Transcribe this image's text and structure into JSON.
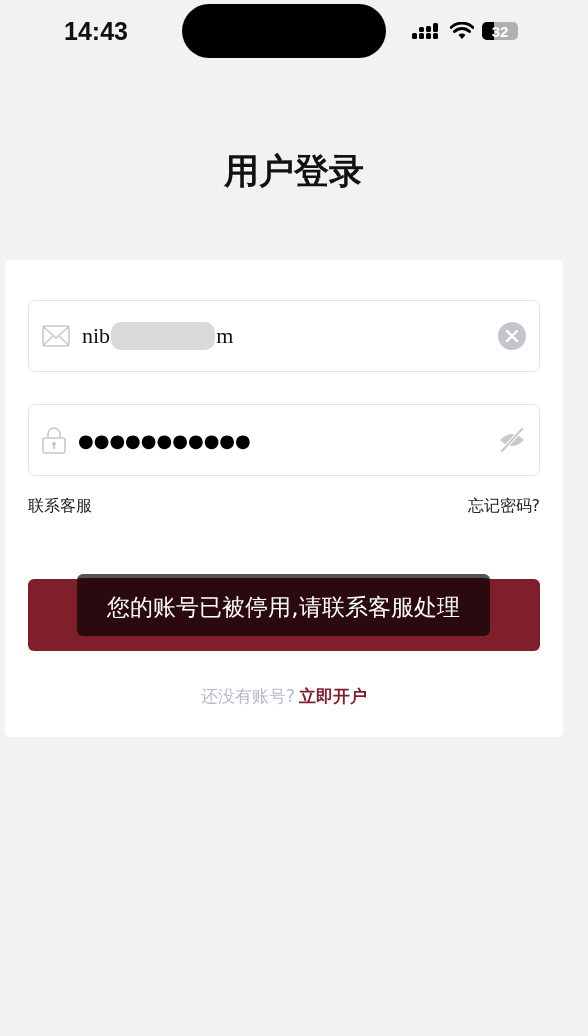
{
  "status_bar": {
    "time": "14:43",
    "battery": {
      "text": "32",
      "level": 0.32
    }
  },
  "title": "用户登录",
  "email_field": {
    "value_start": "nib",
    "value_end": "m"
  },
  "password_field": {
    "value": "●●●●●●●●●●●"
  },
  "contact_link": "联系客服",
  "forgot_link": "忘记密码?",
  "toast": "您的账号已被停用,请联系客服处理",
  "signup": {
    "prompt": "还没有账号?",
    "link": "立即开户"
  }
}
